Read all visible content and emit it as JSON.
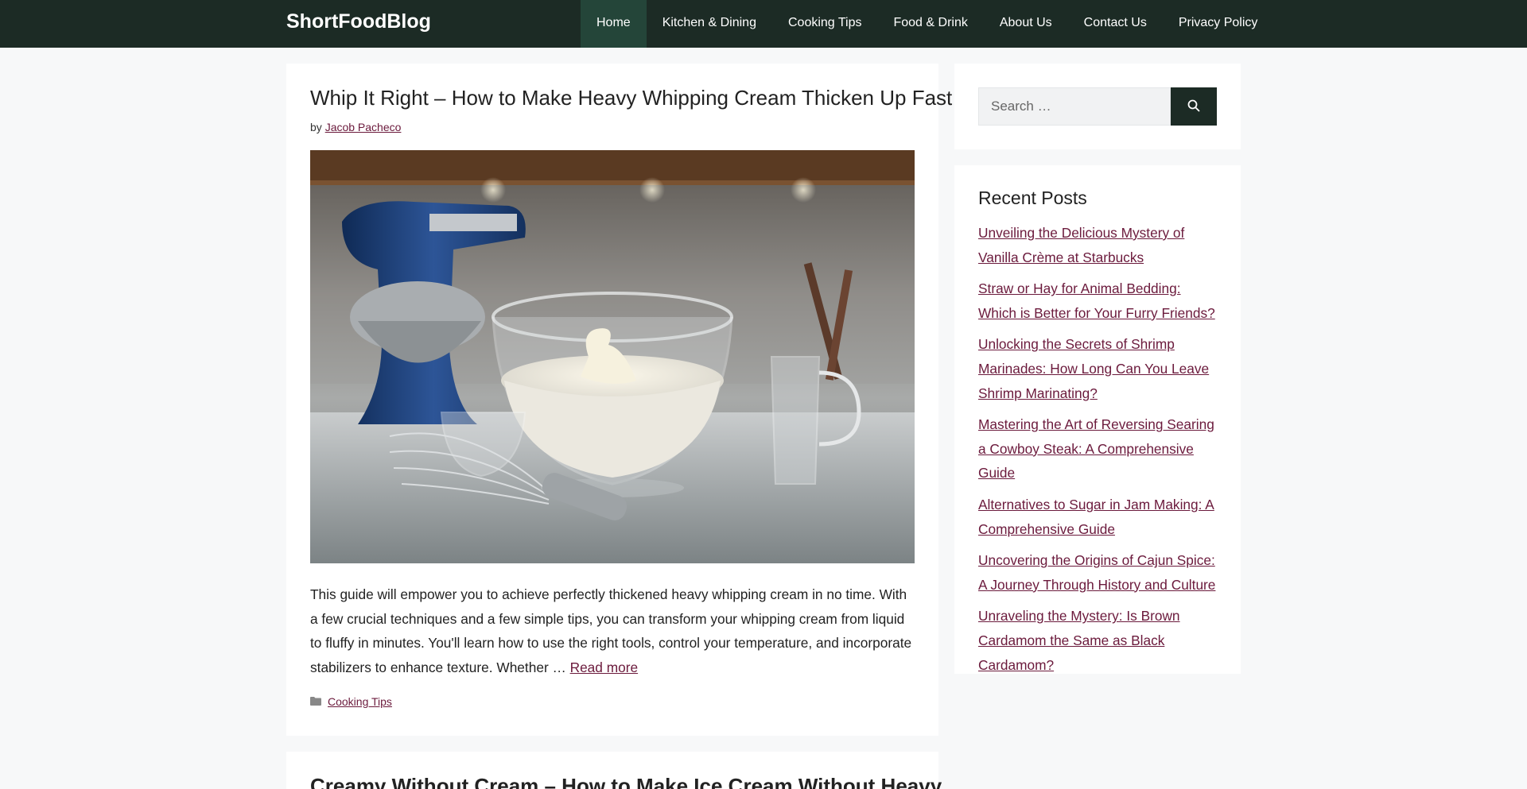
{
  "site": {
    "title": "ShortFoodBlog"
  },
  "nav": {
    "items": [
      {
        "label": "Home"
      },
      {
        "label": "Kitchen & Dining"
      },
      {
        "label": "Cooking Tips"
      },
      {
        "label": "Food & Drink"
      },
      {
        "label": "About Us"
      },
      {
        "label": "Contact Us"
      },
      {
        "label": "Privacy Policy"
      }
    ],
    "active": "Home"
  },
  "post": {
    "title": "Whip It Right – How to Make Heavy Whipping Cream Thicken Up Fast",
    "by_prefix": "by",
    "author": "Jacob Pacheco",
    "excerpt": "This guide will empower you to achieve perfectly thickened heavy whipping cream in no time. With a few crucial techniques and a few simple tips, you can transform your whipping cream from liquid to fluffy in minutes. You'll learn how to use the right tools, control your temperature, and incorporate stabilizers to enhance texture. Whether …",
    "read_more": "Read more",
    "category": "Cooking Tips"
  },
  "next_post": {
    "title": "Creamy Without Cream – How to Make Ice Cream Without Heavy"
  },
  "search": {
    "placeholder": "Search …"
  },
  "recent": {
    "heading": "Recent Posts",
    "items": [
      {
        "label": "Unveiling the Delicious Mystery of Vanilla Crème at Starbucks"
      },
      {
        "label": "Straw or Hay for Animal Bedding: Which is Better for Your Furry Friends?"
      },
      {
        "label": "Unlocking the Secrets of Shrimp Marinades: How Long Can You Leave Shrimp Marinating?"
      },
      {
        "label": "Mastering the Art of Reversing Searing a Cowboy Steak: A Comprehensive Guide"
      },
      {
        "label": "Alternatives to Sugar in Jam Making: A Comprehensive Guide"
      },
      {
        "label": "Uncovering the Origins of Cajun Spice: A Journey Through History and Culture"
      },
      {
        "label": "Unraveling the Mystery: Is Brown Cardamom the Same as Black Cardamom?"
      }
    ]
  },
  "colors": {
    "header_bg": "#1c2b25",
    "nav_active_bg": "#244539",
    "link": "#6b1a3c",
    "page_bg": "#f7f8f9"
  },
  "icons": {
    "search_button": "search-icon",
    "category": "folder-icon"
  }
}
